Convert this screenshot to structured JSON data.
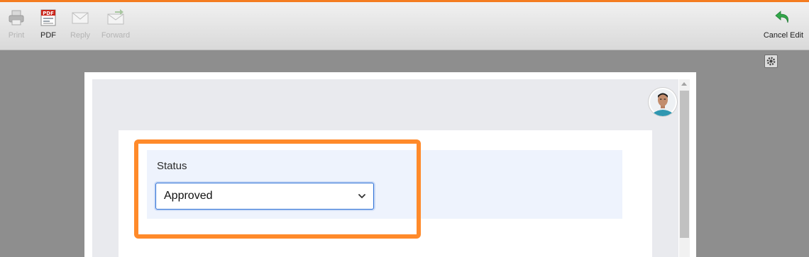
{
  "toolbar": {
    "print_label": "Print",
    "pdf_label": "PDF",
    "reply_label": "Reply",
    "forward_label": "Forward",
    "cancel_edit_label": "Cancel Edit"
  },
  "form": {
    "status_label": "Status",
    "status_value": "Approved"
  },
  "colors": {
    "accent_orange": "#f47c20",
    "highlight_orange": "#ff8a2a",
    "select_border": "#2c6fd6"
  },
  "icons": [
    "printer-icon",
    "pdf-icon",
    "envelope-icon",
    "forward-envelope-icon",
    "undo-arrow-icon",
    "gear-icon",
    "chevron-down-icon"
  ]
}
